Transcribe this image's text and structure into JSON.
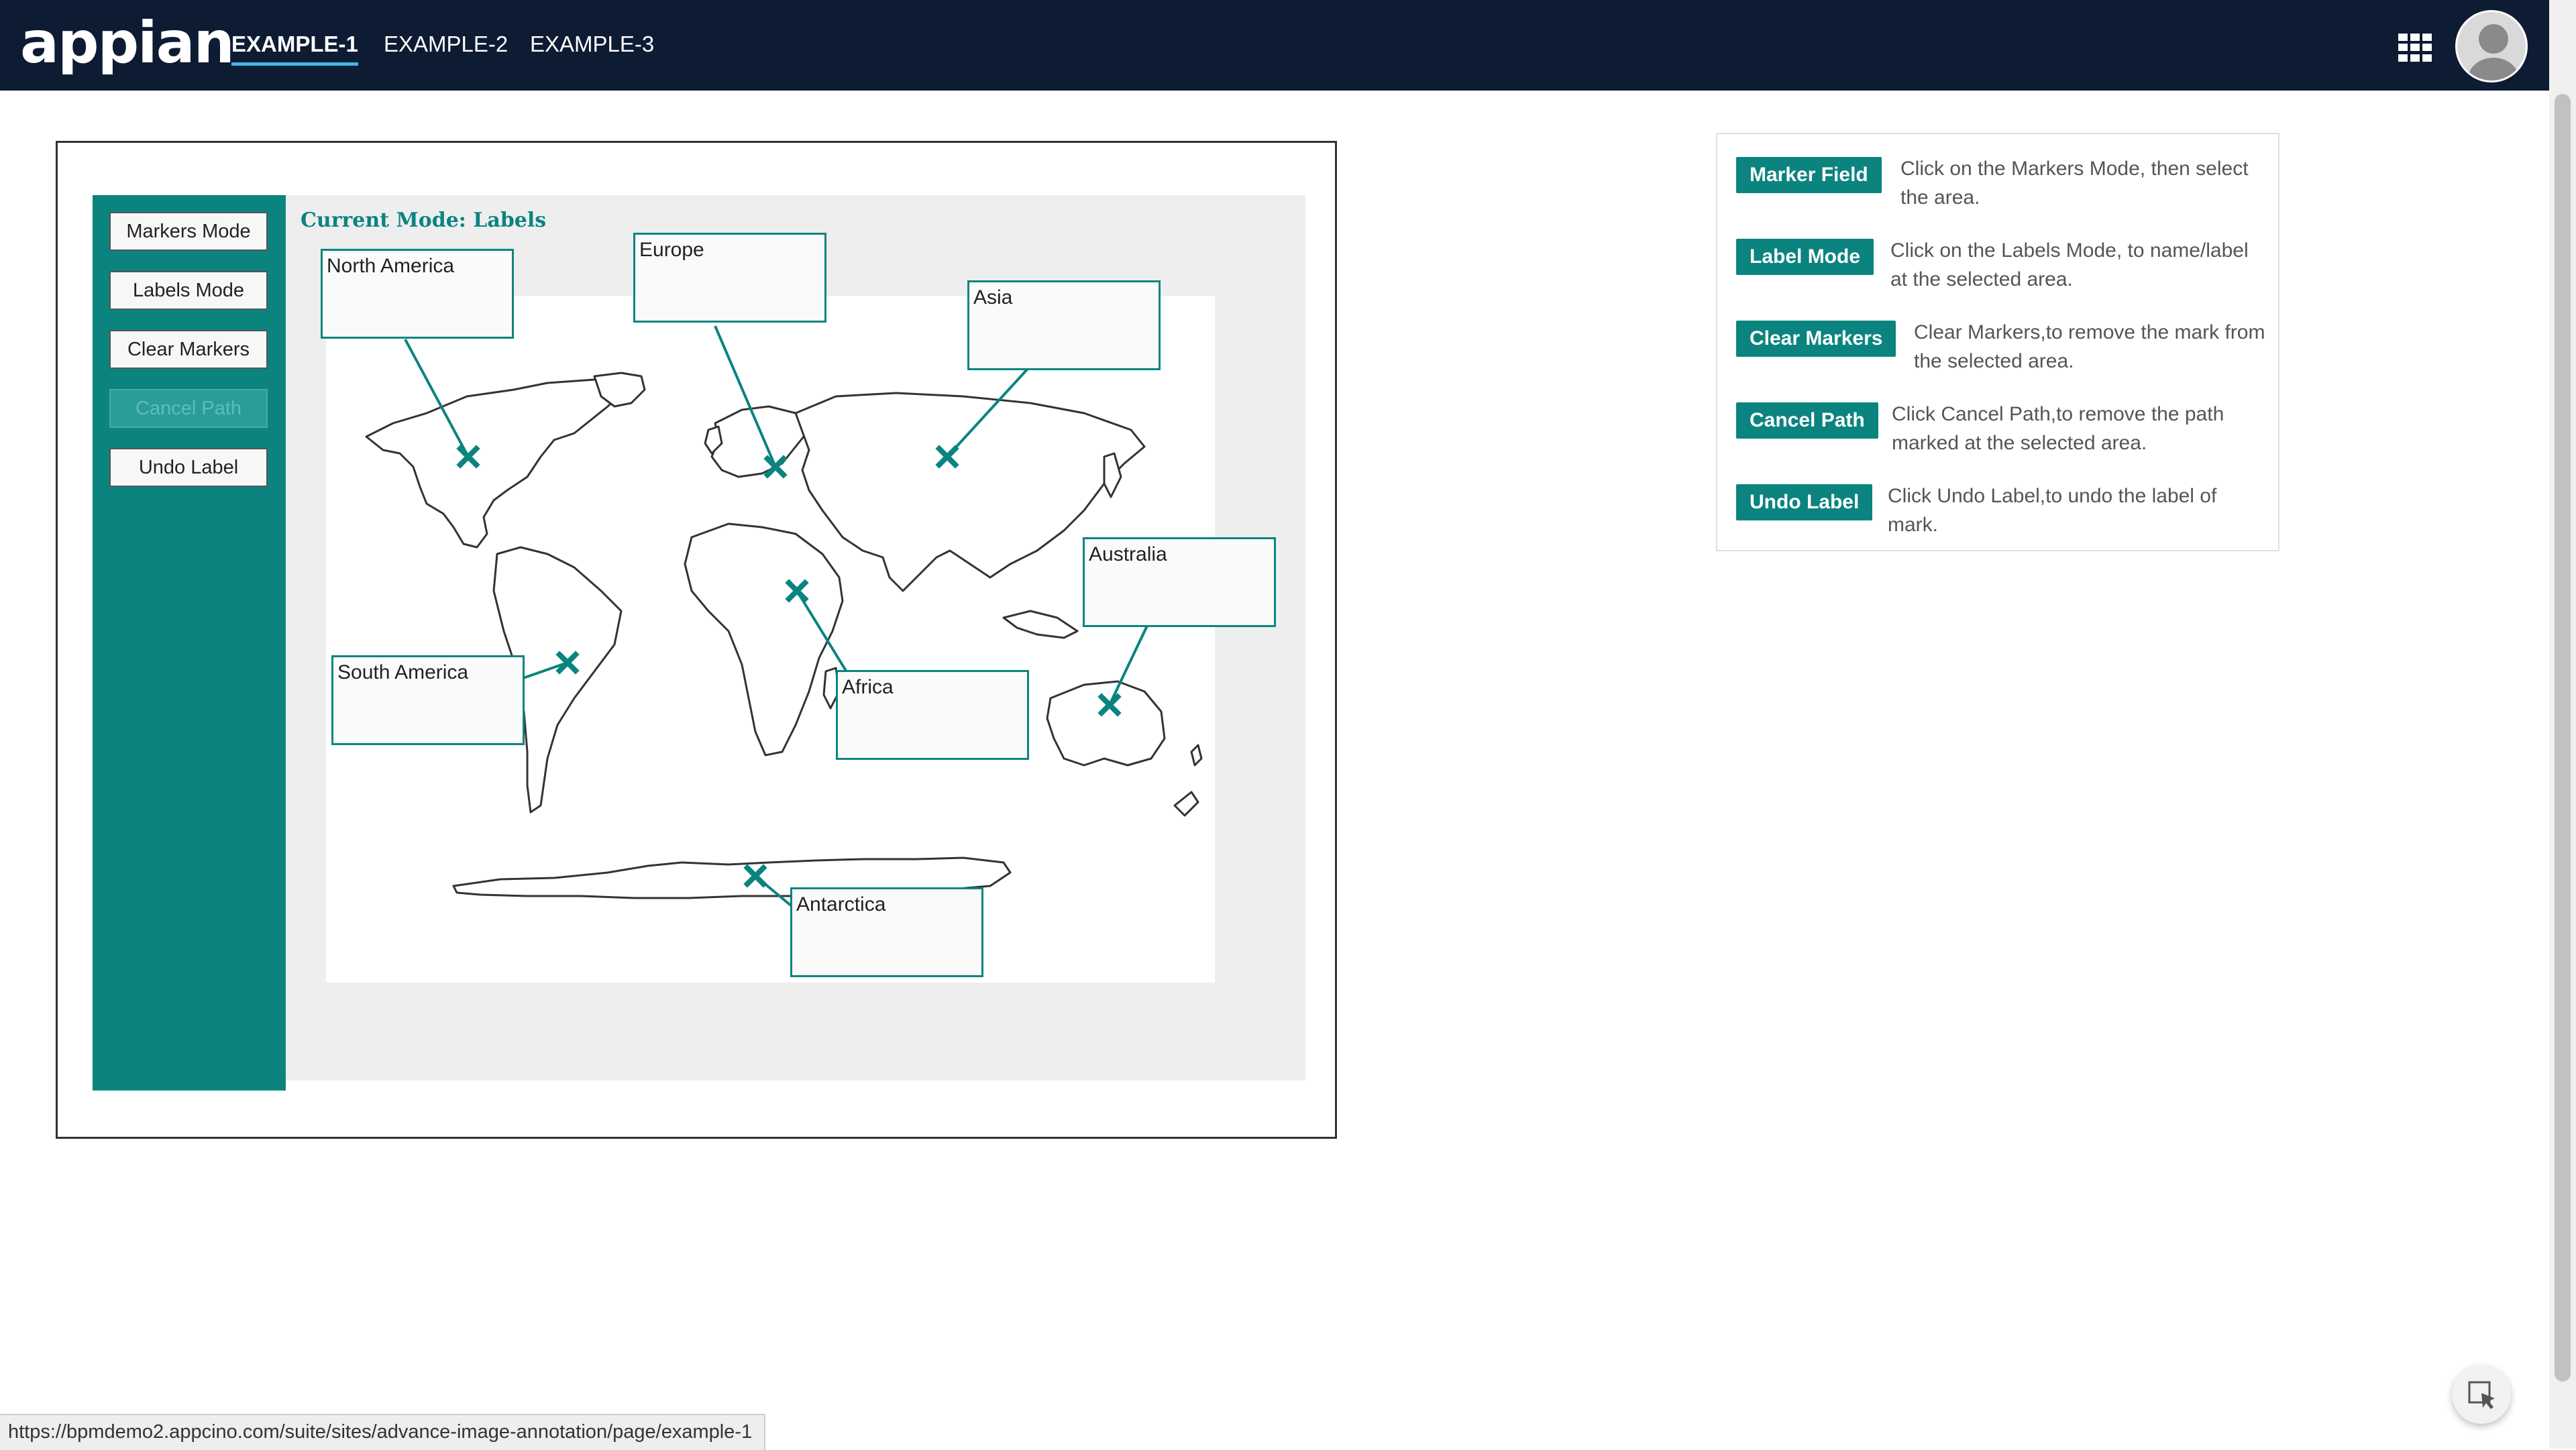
{
  "header": {
    "logo": "appian",
    "tabs": [
      {
        "label": "EXAMPLE-1",
        "active": true
      },
      {
        "label": "EXAMPLE-2",
        "active": false
      },
      {
        "label": "EXAMPLE-3",
        "active": false
      }
    ],
    "icons": {
      "apps": "grid-icon",
      "user": "avatar-icon"
    }
  },
  "sidebar": {
    "buttons": [
      {
        "label": "Markers Mode",
        "disabled": false
      },
      {
        "label": "Labels Mode",
        "disabled": false
      },
      {
        "label": "Clear Markers",
        "disabled": false
      },
      {
        "label": "Cancel Path",
        "disabled": true
      },
      {
        "label": "Undo Label",
        "disabled": false
      }
    ]
  },
  "canvas": {
    "mode_text": "Current Mode: Labels",
    "labels": [
      "North America",
      "Europe",
      "Asia",
      "Australia",
      "South America",
      "Africa",
      "Antarctica"
    ],
    "marker_icon": "x-marker-icon"
  },
  "legend": {
    "items": [
      {
        "badge": "Marker Field",
        "desc": "Click on the Markers Mode, then select the area."
      },
      {
        "badge": "Label Mode",
        "desc": "Click on the Labels Mode, to name/label at the selected area."
      },
      {
        "badge": "Clear Markers",
        "desc": "Clear Markers,to remove the mark from the selected area."
      },
      {
        "badge": "Cancel Path",
        "desc": "Click Cancel Path,to remove the path marked at the selected area."
      },
      {
        "badge": "Undo Label",
        "desc": "Click Undo Label,to undo the label of mark."
      }
    ]
  },
  "status": {
    "url": "https://bpmdemo2.appcino.com/suite/sites/advance-image-annotation/page/example-1"
  },
  "colors": {
    "header_bg": "#0d1b33",
    "accent": "#0b8480",
    "tab_underline": "#41b6e6"
  }
}
